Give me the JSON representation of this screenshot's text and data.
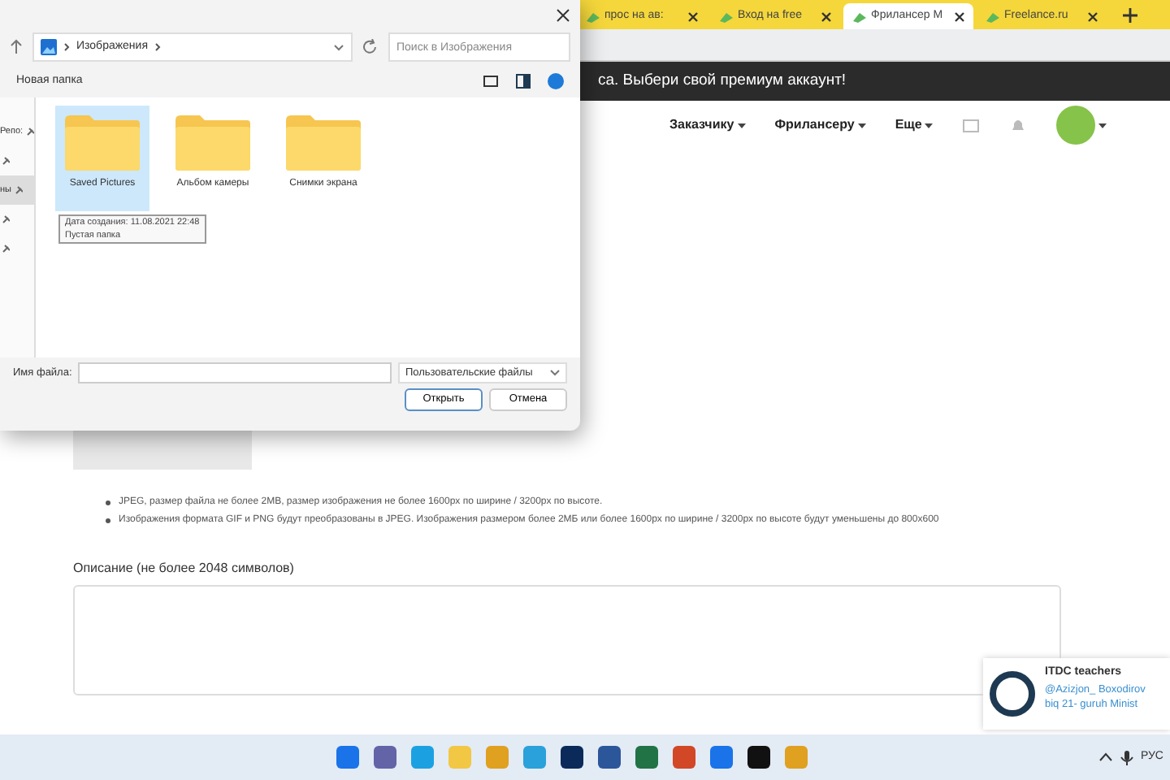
{
  "browser_tabs": [
    {
      "label": "прос на ав:",
      "selected": false
    },
    {
      "label": "Вход на free",
      "selected": false
    },
    {
      "label": "Фрилансер М",
      "selected": true
    },
    {
      "label": "Freelance.ru",
      "selected": false
    }
  ],
  "banner": "са. Выбери свой премиум аккаунт!",
  "site_nav": [
    "Заказчику",
    "Фрилансеру",
    "Еще"
  ],
  "requirements": [
    "JPEG, размер файла не более 2MB, размер изображения не более 1600px по ширине / 3200px по высоте.",
    "Изображения формата GIF и PNG будут преобразованы в JPEG. Изображения размером более 2МБ или более 1600px по ширине / 3200px по высоте будут уменьшены до 800х600"
  ],
  "description_label": "Описание (не более 2048 символов)",
  "notification": {
    "title": "ITDC teachers",
    "lines": [
      "@Azizjon_ Boxodirov",
      "biq 21- guruh Minist"
    ]
  },
  "tray": {
    "language": "РУС"
  },
  "dialog": {
    "path": "Изображения",
    "search": {
      "placeholder": "Поиск в Изображения"
    },
    "new_folder": "Новая папка",
    "nav_items": [
      {
        "label": "Репо:",
        "selected": false
      },
      {
        "selected": false
      },
      {
        "label": "ны",
        "selected": true
      },
      {
        "selected": false
      },
      {
        "selected": false
      }
    ],
    "folders": [
      {
        "name": "Saved Pictures",
        "selected": true
      },
      {
        "name": "Альбом камеры",
        "selected": false
      },
      {
        "name": "Снимки экрана",
        "selected": false
      }
    ],
    "tooltip": [
      "Дата создания: 11.08.2021 22:48",
      "Пустая папка"
    ],
    "file_name_label": "Имя файла:",
    "file_type": "Пользовательские файлы",
    "buttons": [
      "Открыть",
      "Отмена"
    ]
  }
}
